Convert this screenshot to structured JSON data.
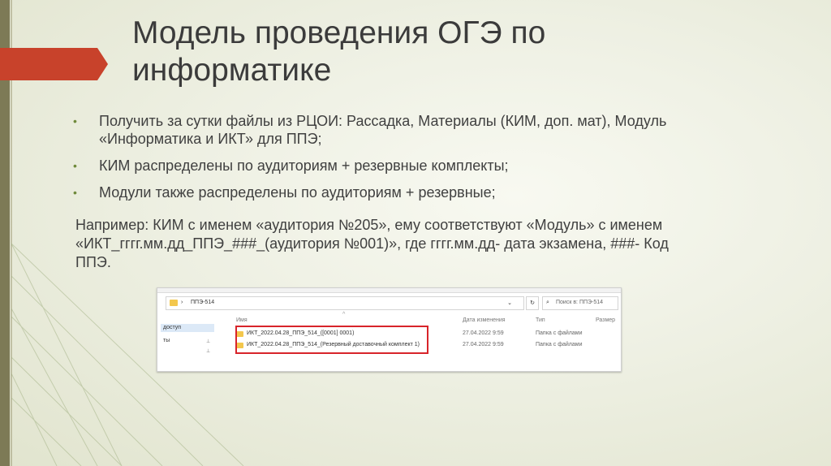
{
  "slide": {
    "title_lines": [
      "Модель проведения ОГЭ по",
      "информатике"
    ],
    "bullets": [
      {
        "lines": [
          "Получить за сутки файлы из РЦОИ: Рассадка, Материалы (КИМ, доп. мат), Модуль",
          "«Информатика и ИКТ» для ППЭ;"
        ]
      },
      {
        "lines": [
          "КИМ распределены по аудиториям + резервные комплекты;"
        ]
      },
      {
        "lines": [
          "Модули также распределены по аудиториям + резервные;"
        ]
      }
    ],
    "bullet_marker": "•",
    "paragraph_lines": [
      "Например: КИМ с именем «аудитория №205», ему соответствуют «Модуль» с именем",
      "«ИКТ_гггг.мм.дд_ППЭ_###_(аудитория №001)», где гггг.мм.дд- дата экзамена, ###- Код",
      "ППЭ."
    ],
    "colors": {
      "accent_red": "#c8422b",
      "accent_green": "#6f8a3b",
      "highlight_red": "#d8242a",
      "folder_yellow": "#f3c74d"
    }
  },
  "explorer": {
    "address_sep": "›",
    "address_path": "ППЭ-514",
    "dropdown_glyph": "⌄",
    "refresh_glyph": "↻",
    "search_icon": "⌕",
    "search_placeholder": "Поиск в: ППЭ-514",
    "nav_items": [
      "доступ",
      "ты"
    ],
    "columns": {
      "name": "Имя",
      "date": "Дата изменения",
      "type": "Тип",
      "size": "Размер"
    },
    "sort_arrow": "^",
    "rows": [
      {
        "name": "ИКТ_2022.04.28_ППЭ_514_([0001] 0001)",
        "date": "27.04.2022 9:59",
        "type": "Папка с файлами"
      },
      {
        "name": "ИКТ_2022.04.28_ППЭ_514_(Резервный доставочный комплект 1)",
        "date": "27.04.2022 9:59",
        "type": "Папка с файлами"
      }
    ]
  }
}
